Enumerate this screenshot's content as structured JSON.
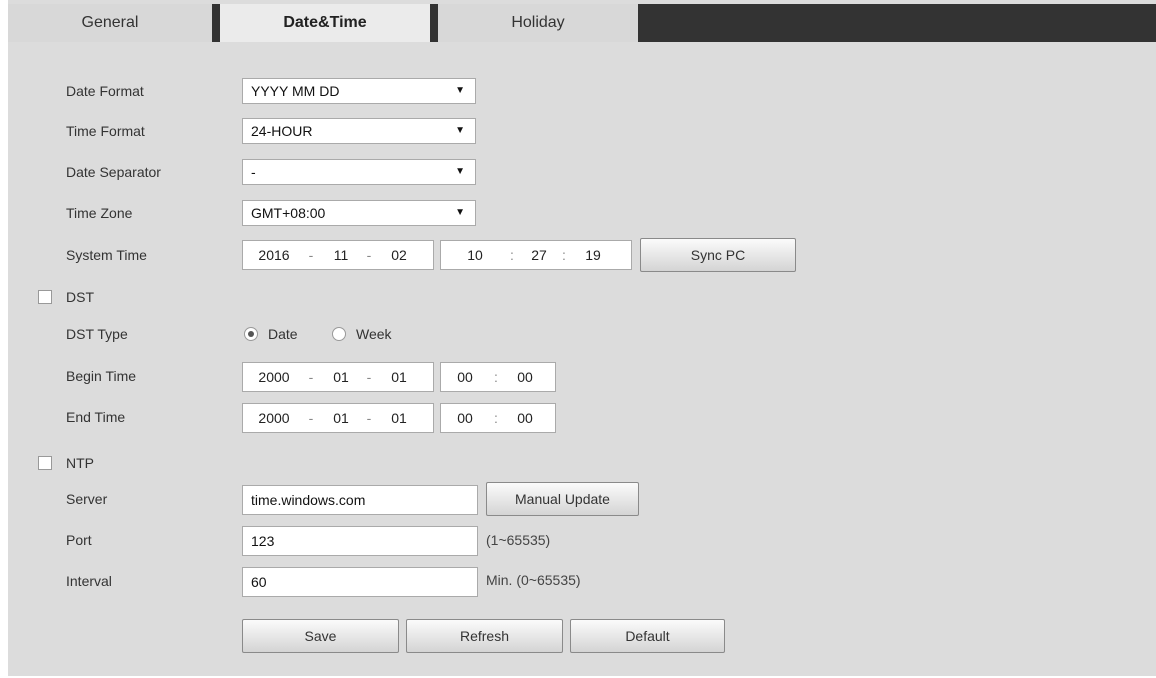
{
  "tabs": [
    "General",
    "Date&Time",
    "Holiday"
  ],
  "labels": {
    "date_format": "Date Format",
    "time_format": "Time Format",
    "date_separator": "Date Separator",
    "time_zone": "Time Zone",
    "system_time": "System Time",
    "dst": "DST",
    "dst_type": "DST Type",
    "begin_time": "Begin Time",
    "end_time": "End Time",
    "ntp": "NTP",
    "server": "Server",
    "port": "Port",
    "interval": "Interval"
  },
  "selects": {
    "date_format": "YYYY MM DD",
    "time_format": "24-HOUR",
    "date_separator": "-",
    "time_zone": "GMT+08:00"
  },
  "system_time": {
    "year": "2016",
    "month": "11",
    "day": "02",
    "hour": "10",
    "minute": "27",
    "second": "19"
  },
  "dst_type": {
    "option_date": "Date",
    "option_week": "Week",
    "selected": "Date"
  },
  "begin_time": {
    "year": "2000",
    "month": "01",
    "day": "01",
    "hour": "00",
    "minute": "00"
  },
  "end_time": {
    "year": "2000",
    "month": "01",
    "day": "01",
    "hour": "00",
    "minute": "00"
  },
  "ntp": {
    "server": "time.windows.com",
    "port": "123",
    "port_hint": "(1~65535)",
    "interval": "60",
    "interval_hint": "Min. (0~65535)"
  },
  "separators": {
    "date": "-",
    "time": ":"
  },
  "buttons": {
    "sync_pc": "Sync PC",
    "manual_update": "Manual Update",
    "save": "Save",
    "refresh": "Refresh",
    "default": "Default"
  },
  "checkboxes": {
    "dst": false,
    "ntp": false
  },
  "colors": {
    "tab_bar": "#333333",
    "panel": "#dcdcdc",
    "active_tab": "#ebebeb"
  }
}
